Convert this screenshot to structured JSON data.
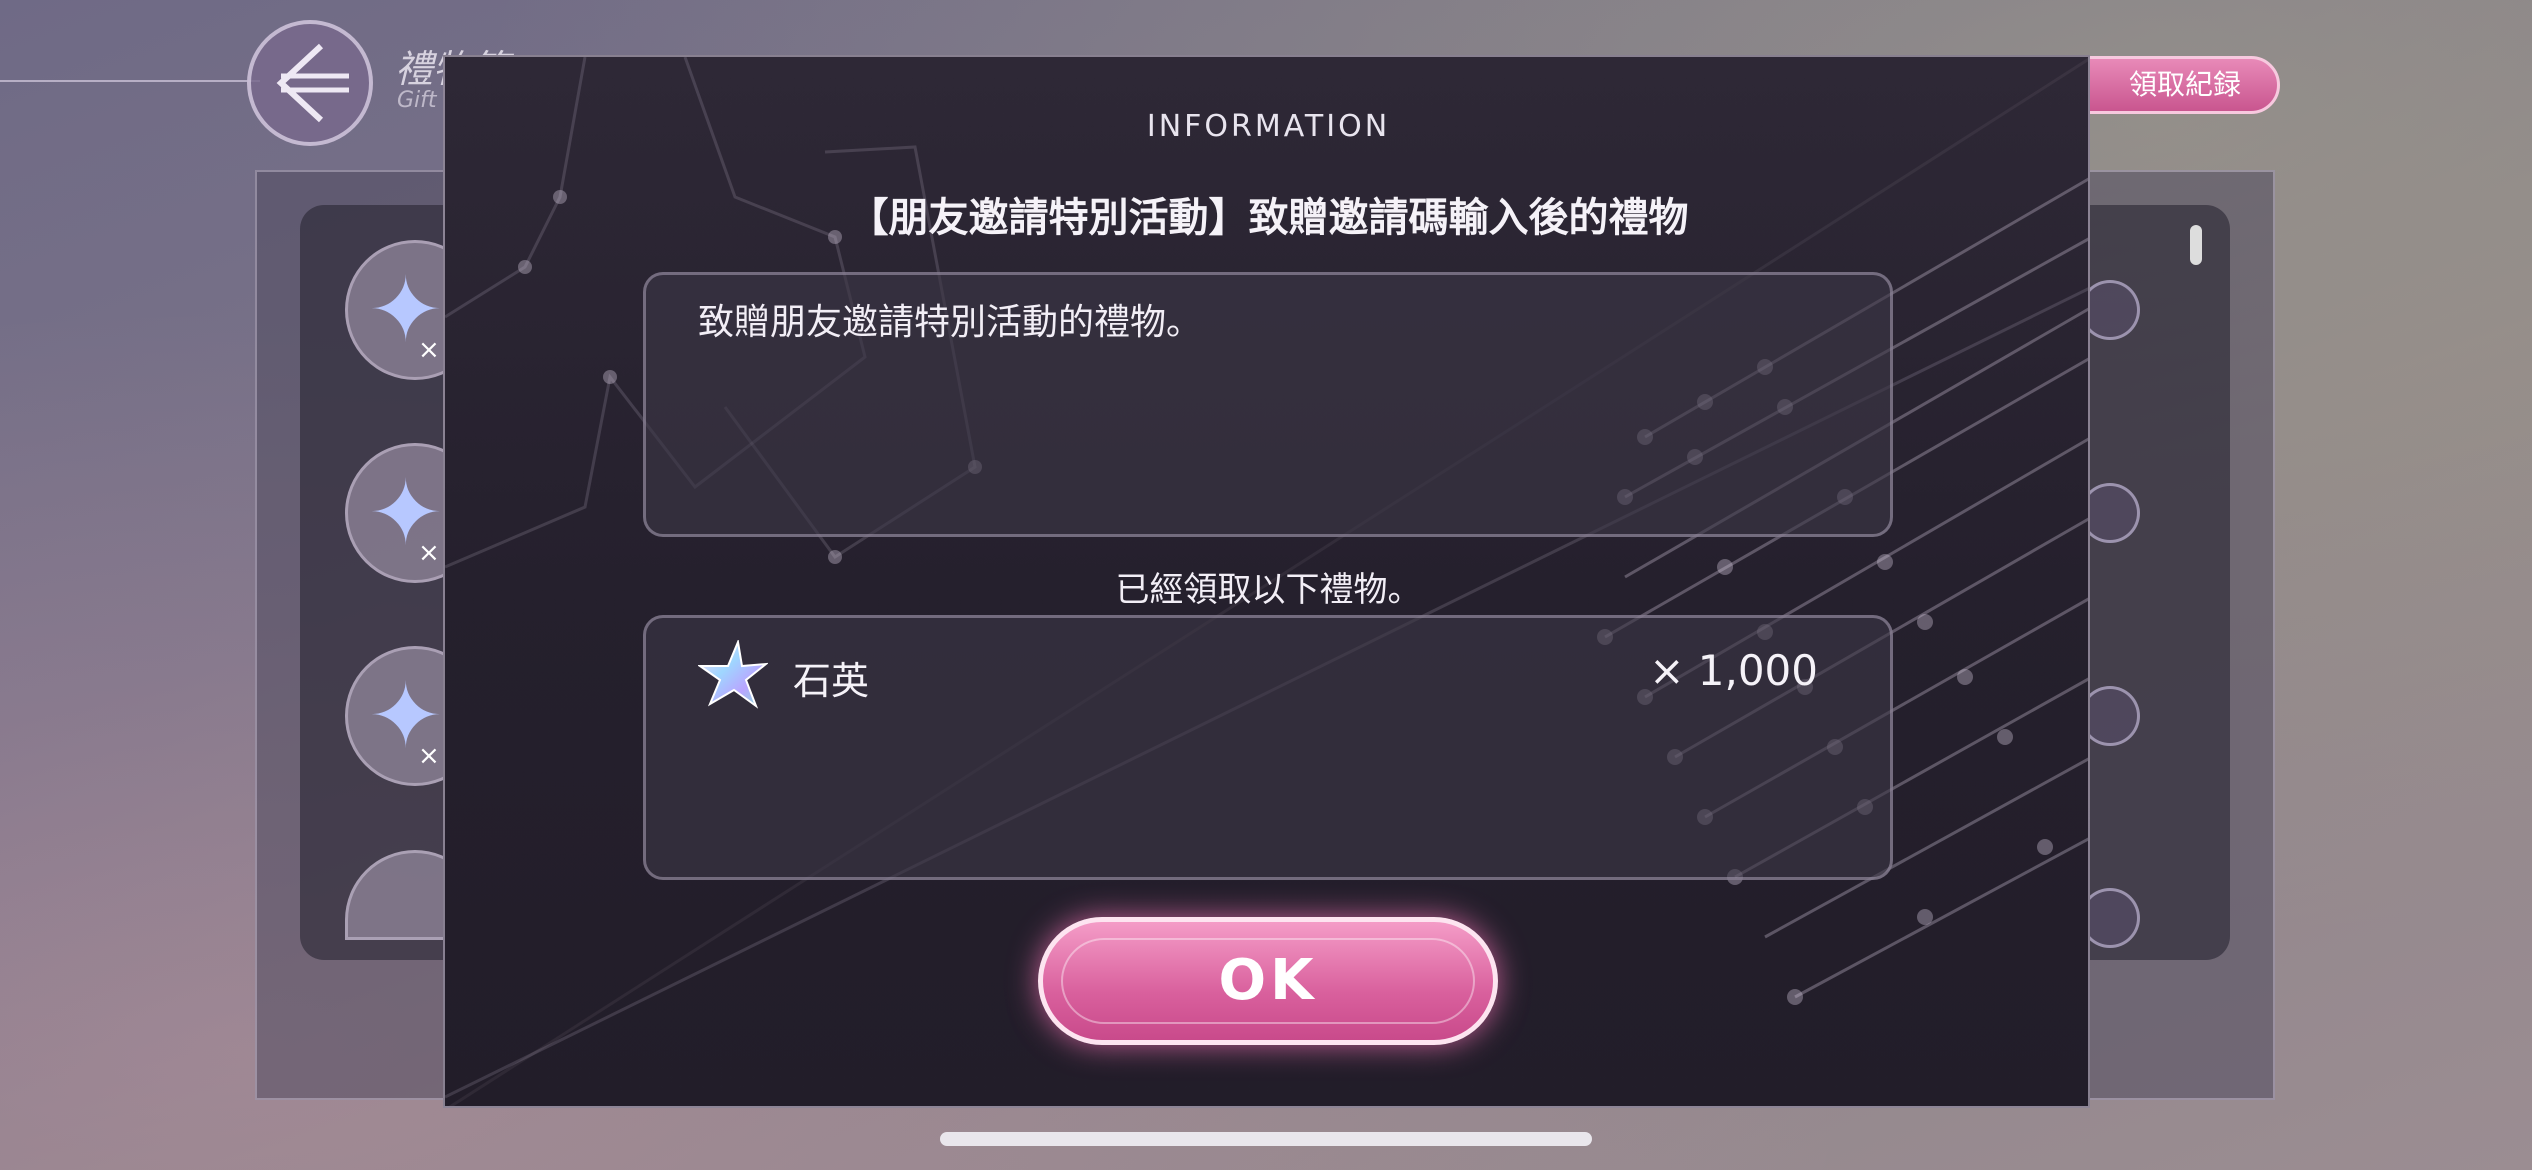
{
  "background": {
    "page_title": "禮物箱",
    "page_subtitle": "Gift",
    "history_button": "領取紀録"
  },
  "dialog": {
    "header": "INFORMATION",
    "title": "【朋友邀請特別活動】致贈邀請碼輸入後的禮物",
    "description": "致贈朋友邀請特別活動的禮物。",
    "received_label": "已經領取以下禮物。",
    "items": [
      {
        "name": "石英",
        "quantity": "× 1,000",
        "icon": "quartz-star-icon"
      }
    ],
    "ok_label": "OK"
  },
  "colors": {
    "accent_pink": "#d9609d",
    "dialog_bg": "#25202d"
  }
}
